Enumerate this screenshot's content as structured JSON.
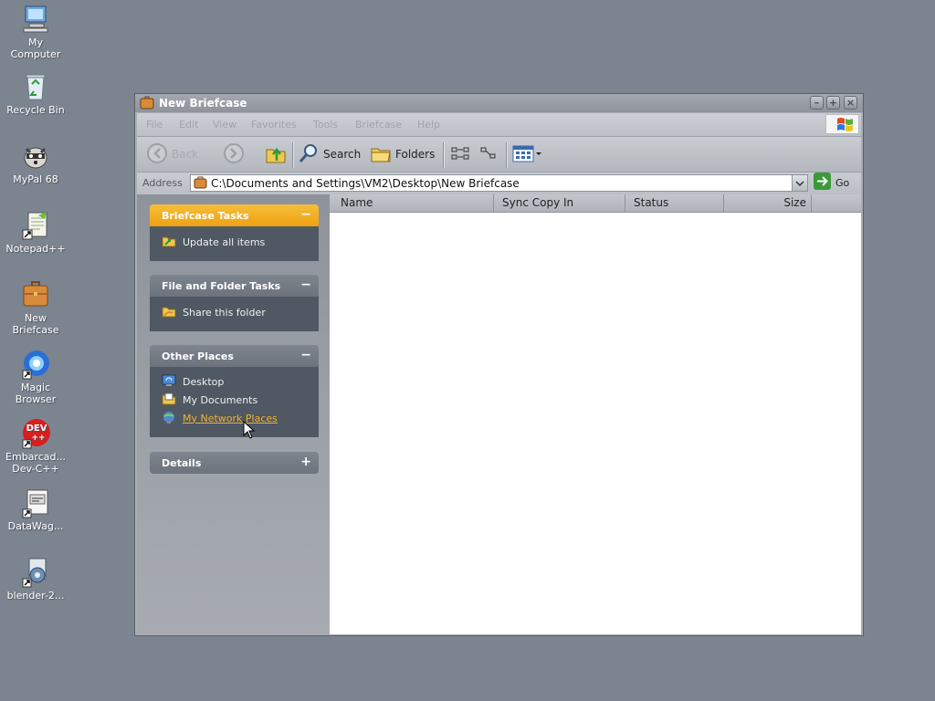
{
  "desktop": {
    "icons": [
      {
        "label": "My\nComputer",
        "icon": "my-computer-icon"
      },
      {
        "label": "Recycle Bin",
        "icon": "recycle-bin-icon"
      },
      {
        "label": "MyPal 68",
        "icon": "mypal-raccoon-icon"
      },
      {
        "label": "Notepad++",
        "icon": "notepadpp-icon"
      },
      {
        "label": "New\nBriefcase",
        "icon": "briefcase-icon"
      },
      {
        "label": "Magic\nBrowser",
        "icon": "magic-browser-icon"
      },
      {
        "label": "Embarcad...\nDev-C++",
        "icon": "devcpp-icon"
      },
      {
        "label": "DataWag...",
        "icon": "datawag-icon"
      },
      {
        "label": "blender-2...",
        "icon": "blender-installer-icon"
      }
    ]
  },
  "window": {
    "title": "New Briefcase",
    "menu": [
      "File",
      "Edit",
      "View",
      "Favorites",
      "Tools",
      "Briefcase",
      "Help"
    ],
    "toolbar": {
      "back": "Back",
      "search": "Search",
      "folders": "Folders"
    },
    "address": {
      "label": "Address",
      "path": "C:\\Documents and Settings\\VM2\\Desktop\\New Briefcase",
      "go": "Go"
    },
    "tasks": {
      "briefcase": {
        "title": "Briefcase Tasks",
        "toggle": "−",
        "items": [
          "Update all items"
        ]
      },
      "file_folder": {
        "title": "File and Folder Tasks",
        "toggle": "−",
        "items": [
          "Share this folder"
        ]
      },
      "other_places": {
        "title": "Other Places",
        "toggle": "−",
        "items": [
          "Desktop",
          "My Documents",
          "My Network Places"
        ]
      },
      "details": {
        "title": "Details",
        "toggle": "+"
      }
    },
    "columns": [
      "Name",
      "Sync Copy In",
      "Status",
      "Size"
    ]
  },
  "colors": {
    "desktop_bg": "#7c8490",
    "briefcase_header": "#f0a818",
    "panel_body": "#4f5863",
    "link_hover": "#f0b030"
  }
}
